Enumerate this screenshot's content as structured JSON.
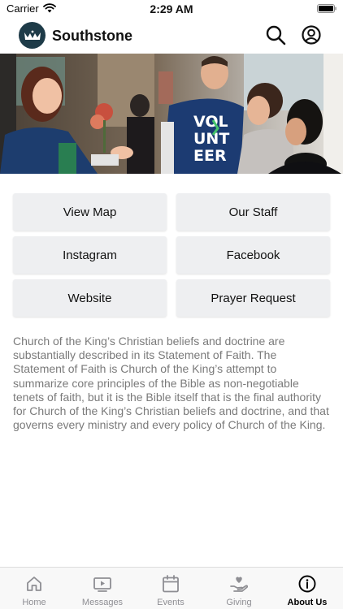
{
  "status_bar": {
    "carrier": "Carrier",
    "time": "2:29 AM"
  },
  "header": {
    "title": "Southstone"
  },
  "hero": {
    "shirt_text": [
      "VOL",
      "UNT",
      "EER"
    ]
  },
  "links": [
    {
      "label": "View Map"
    },
    {
      "label": "Our Staff"
    },
    {
      "label": "Instagram"
    },
    {
      "label": "Facebook"
    },
    {
      "label": "Website"
    },
    {
      "label": "Prayer Request"
    }
  ],
  "description": "Church of the King’s Christian beliefs and doctrine are substantially described in its Statement of Faith. The Statement of Faith is Church of the King’s attempt to summarize core principles of the Bible as non-negotiable tenets of faith, but it is the Bible itself that is the final authority for Church of the King’s Christian beliefs and doctrine, and that governs every ministry and every policy of Church of the King.",
  "tabs": [
    {
      "label": "Home",
      "icon": "home-icon",
      "active": false
    },
    {
      "label": "Messages",
      "icon": "video-icon",
      "active": false
    },
    {
      "label": "Events",
      "icon": "calendar-icon",
      "active": false
    },
    {
      "label": "Giving",
      "icon": "giving-hand-icon",
      "active": false
    },
    {
      "label": "About Us",
      "icon": "info-icon",
      "active": true
    }
  ]
}
